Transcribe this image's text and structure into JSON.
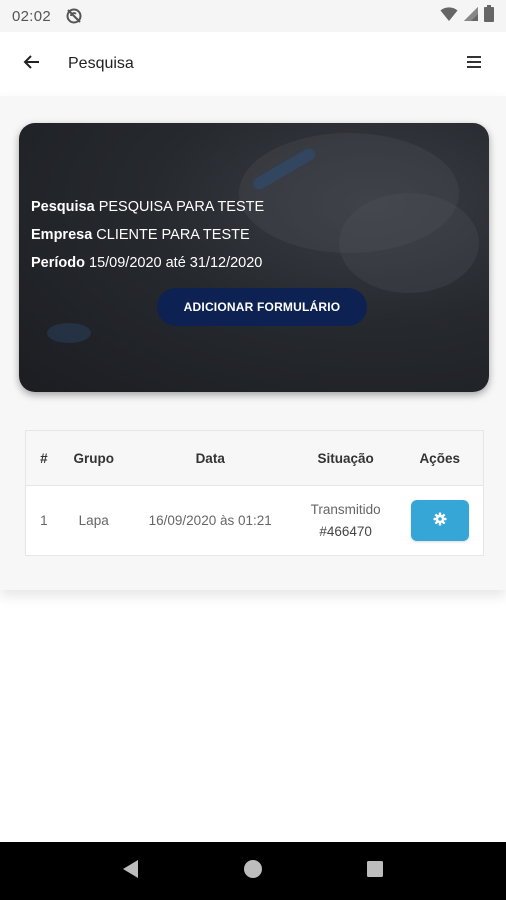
{
  "status_bar": {
    "time": "02:02",
    "icons": [
      "sync-disabled-icon",
      "wifi-icon",
      "signal-icon",
      "battery-icon"
    ]
  },
  "app_bar": {
    "title": "Pesquisa",
    "back_icon": "arrow-left-icon",
    "menu_icon": "hamburger-menu-icon"
  },
  "hero": {
    "pesquisa_label": "Pesquisa",
    "pesquisa_value": "PESQUISA PARA TESTE",
    "empresa_label": "Empresa",
    "empresa_value": "CLIENTE PARA TESTE",
    "periodo_label": "Período",
    "periodo_value": "15/09/2020 até 31/12/2020",
    "button_label": "ADICIONAR FORMULÁRIO",
    "button_color": "#0d2252"
  },
  "table": {
    "headers": [
      "#",
      "Grupo",
      "Data",
      "Situação",
      "Ações"
    ],
    "rows": [
      {
        "index": "1",
        "grupo": "Lapa",
        "data": "16/09/2020 às 01:21",
        "situacao": "Transmitido",
        "situacao_id": "#466470",
        "action_icon": "gear-icon"
      }
    ],
    "action_color": "#36a6d7"
  },
  "nav_bar": {
    "icons": [
      "back-triangle-icon",
      "home-circle-icon",
      "recents-square-icon"
    ]
  }
}
